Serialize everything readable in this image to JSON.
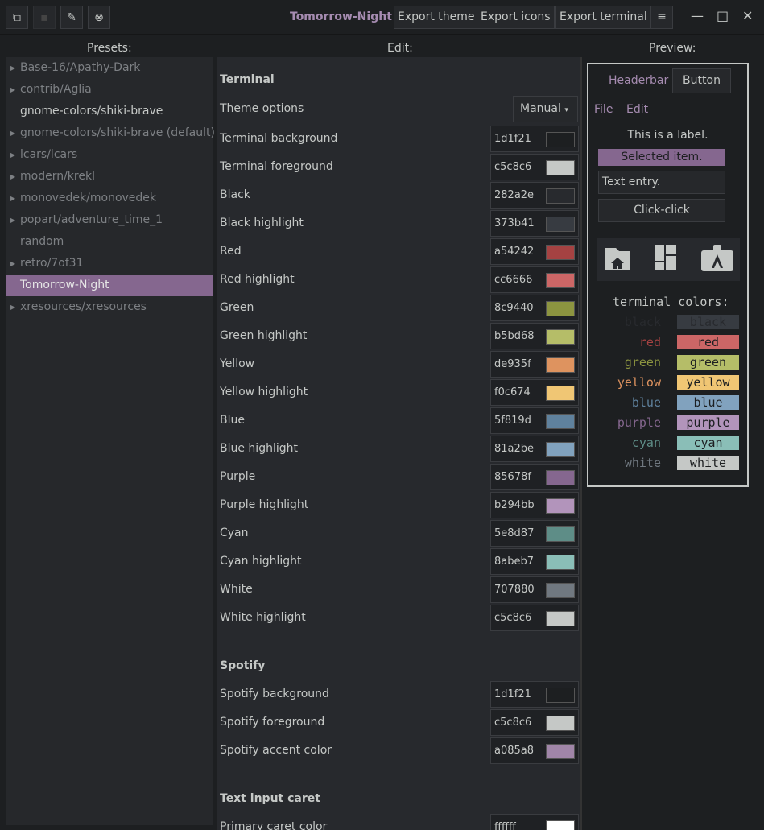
{
  "header": {
    "title": "Tomorrow-Night",
    "export_theme": "Export theme",
    "export_icons": "Export icons",
    "export_terminal": "Export terminal"
  },
  "labels": {
    "presets": "Presets:",
    "edit": "Edit:",
    "preview": "Preview:"
  },
  "presets": [
    {
      "label": "Base-16/Apathy-Dark",
      "arrow": true,
      "style": "dim"
    },
    {
      "label": "contrib/Aglia",
      "arrow": true,
      "style": "dim"
    },
    {
      "label": "gnome-colors/shiki-brave",
      "arrow": false,
      "style": "white"
    },
    {
      "label": "gnome-colors/shiki-brave (default)",
      "arrow": true,
      "style": "dim"
    },
    {
      "label": "lcars/lcars",
      "arrow": true,
      "style": "dim"
    },
    {
      "label": "modern/krekl",
      "arrow": true,
      "style": "dim"
    },
    {
      "label": "monovedek/monovedek",
      "arrow": true,
      "style": "dim"
    },
    {
      "label": "popart/adventure_time_1",
      "arrow": true,
      "style": "dim"
    },
    {
      "label": "random",
      "arrow": false,
      "style": "dim"
    },
    {
      "label": "retro/7of31",
      "arrow": true,
      "style": "dim"
    },
    {
      "label": "Tomorrow-Night",
      "arrow": false,
      "style": "sel"
    },
    {
      "label": "xresources/xresources",
      "arrow": true,
      "style": "dim"
    }
  ],
  "edit": {
    "terminal_title": "Terminal",
    "theme_options_label": "Theme options",
    "theme_options_value": "Manual",
    "terminal_rows": [
      {
        "name": "Terminal background",
        "hex": "1d1f21"
      },
      {
        "name": "Terminal foreground",
        "hex": "c5c8c6"
      },
      {
        "name": "Black",
        "hex": "282a2e"
      },
      {
        "name": "Black highlight",
        "hex": "373b41"
      },
      {
        "name": "Red",
        "hex": "a54242"
      },
      {
        "name": "Red highlight",
        "hex": "cc6666"
      },
      {
        "name": "Green",
        "hex": "8c9440"
      },
      {
        "name": "Green highlight",
        "hex": "b5bd68"
      },
      {
        "name": "Yellow",
        "hex": "de935f"
      },
      {
        "name": "Yellow highlight",
        "hex": "f0c674"
      },
      {
        "name": "Blue",
        "hex": "5f819d"
      },
      {
        "name": "Blue highlight",
        "hex": "81a2be"
      },
      {
        "name": "Purple",
        "hex": "85678f"
      },
      {
        "name": "Purple highlight",
        "hex": "b294bb"
      },
      {
        "name": "Cyan",
        "hex": "5e8d87"
      },
      {
        "name": "Cyan highlight",
        "hex": "8abeb7"
      },
      {
        "name": "White",
        "hex": "707880"
      },
      {
        "name": "White highlight",
        "hex": "c5c8c6"
      }
    ],
    "spotify_title": "Spotify",
    "spotify_rows": [
      {
        "name": "Spotify background",
        "hex": "1d1f21"
      },
      {
        "name": "Spotify foreground",
        "hex": "c5c8c6"
      },
      {
        "name": "Spotify accent color",
        "hex": "a085a8"
      }
    ],
    "caret_title": "Text input caret",
    "caret_rows": [
      {
        "name": "Primary caret color",
        "hex": "ffffff"
      }
    ]
  },
  "preview": {
    "headerbar": "Headerbar",
    "button": "Button",
    "menu_file": "File",
    "menu_edit": "Edit",
    "label": "This is a label.",
    "selected": "Selected item.",
    "entry": "Text entry.",
    "click": "Click-click",
    "terminal_title": "terminal colors:",
    "terminal": [
      {
        "name": "black",
        "fg": "#282a2e",
        "bg": "#373b41"
      },
      {
        "name": "red",
        "fg": "#a54242",
        "bg": "#cc6666"
      },
      {
        "name": "green",
        "fg": "#8c9440",
        "bg": "#b5bd68"
      },
      {
        "name": "yellow",
        "fg": "#de935f",
        "bg": "#f0c674"
      },
      {
        "name": "blue",
        "fg": "#5f819d",
        "bg": "#81a2be"
      },
      {
        "name": "purple",
        "fg": "#85678f",
        "bg": "#b294bb"
      },
      {
        "name": "cyan",
        "fg": "#5e8d87",
        "bg": "#8abeb7"
      },
      {
        "name": "white",
        "fg": "#707880",
        "bg": "#c5c8c6"
      }
    ]
  }
}
